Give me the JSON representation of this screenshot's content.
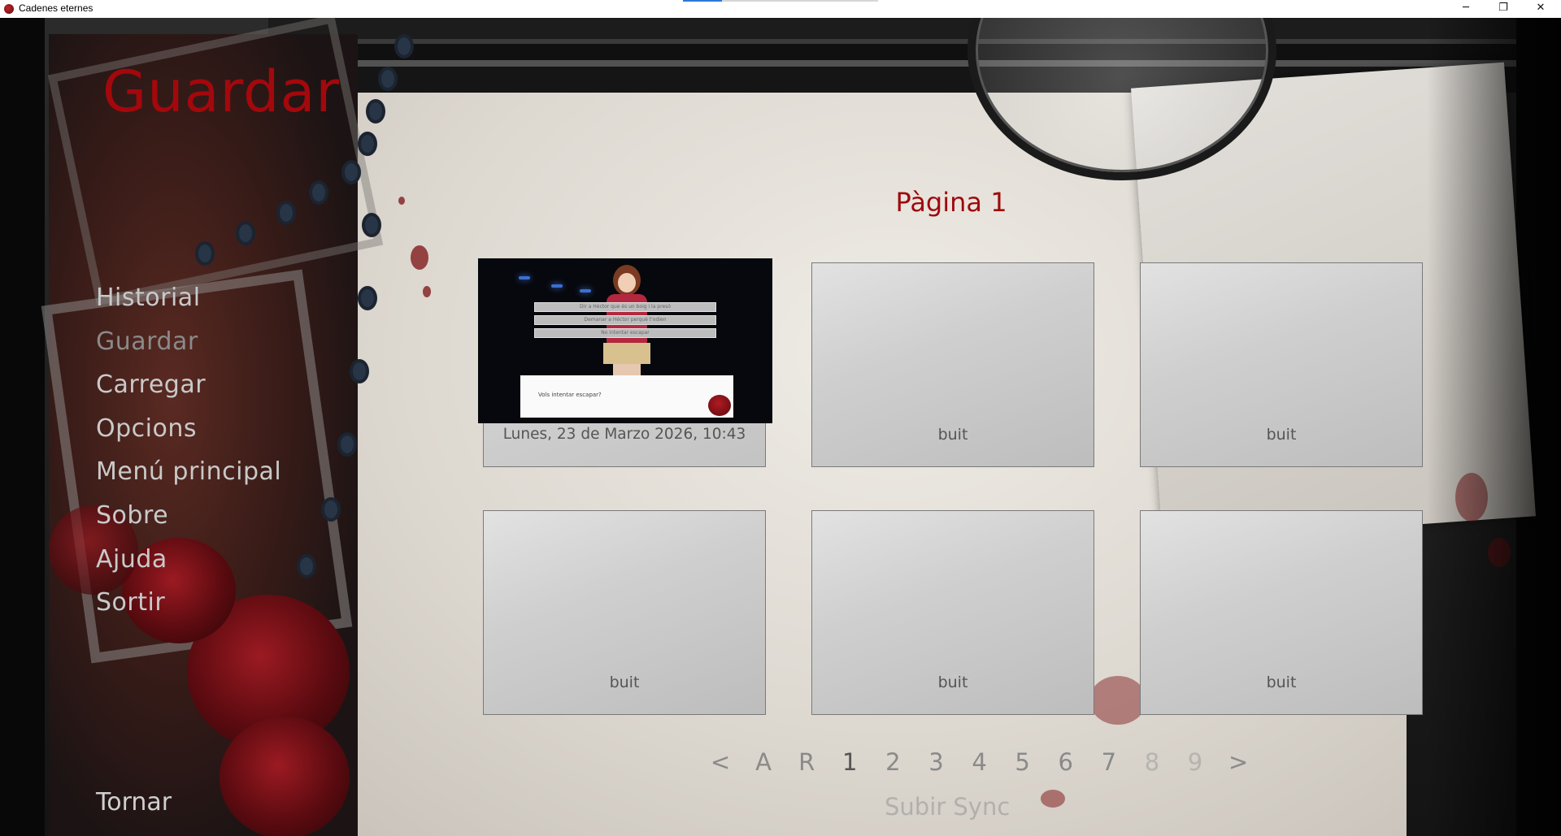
{
  "window": {
    "title": "Cadenes eternes",
    "minimize_glyph": "─",
    "restore_glyph": "❐",
    "close_glyph": "✕"
  },
  "screen": {
    "title": "Guardar",
    "page_title": "Pàgina 1",
    "title_color": "#a3080c"
  },
  "nav": {
    "items": [
      {
        "label": "Historial"
      },
      {
        "label": "Guardar"
      },
      {
        "label": "Carregar"
      },
      {
        "label": "Opcions"
      },
      {
        "label": "Menú principal"
      },
      {
        "label": "Sobre"
      },
      {
        "label": "Ajuda"
      },
      {
        "label": "Sortir"
      }
    ],
    "return_label": "Tornar"
  },
  "slots": [
    {
      "label": "Lunes, 23 de Marzo 2026, 10:43",
      "filled": true,
      "thumbnail": {
        "choices": [
          "Dir a Héctor que és un boig i la presó",
          "Demanar a Héctor perquè t'odien",
          "No intentar escapar"
        ],
        "dialogue": "Vols intentar escapar?"
      }
    },
    {
      "label": "buit",
      "filled": false
    },
    {
      "label": "buit",
      "filled": false
    },
    {
      "label": "buit",
      "filled": false
    },
    {
      "label": "buit",
      "filled": false
    },
    {
      "label": "buit",
      "filled": false
    }
  ],
  "pager": {
    "prev": "<",
    "auto": "A",
    "quick": "R",
    "pages": [
      "1",
      "2",
      "3",
      "4",
      "5",
      "6",
      "7",
      "8",
      "9"
    ],
    "current": "1",
    "next": ">"
  },
  "sync_label": "Subir Sync"
}
